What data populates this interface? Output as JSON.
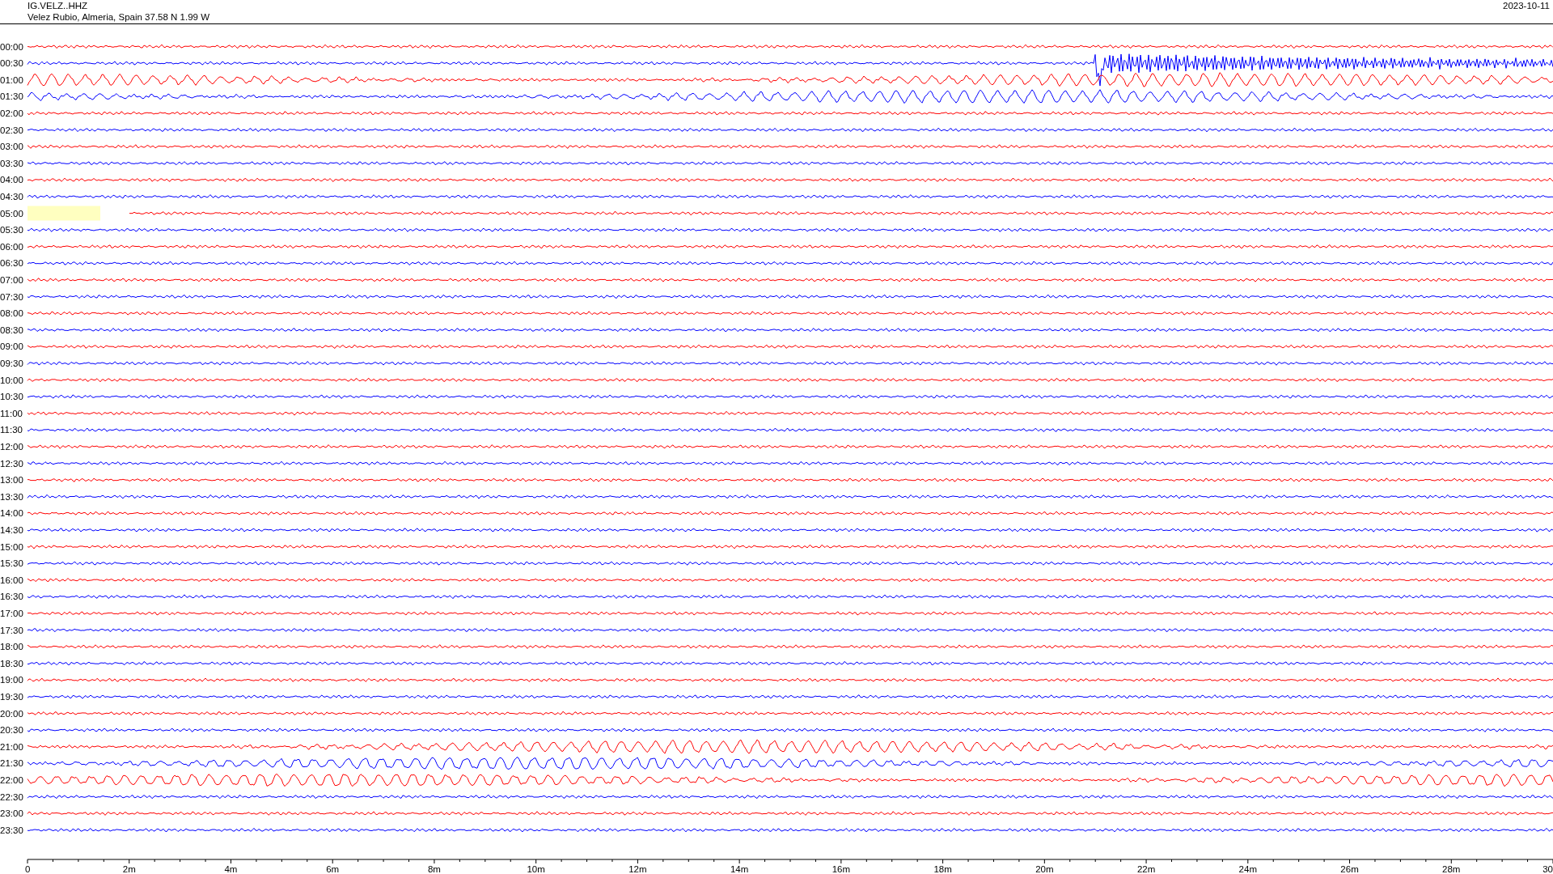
{
  "header": {
    "station": "IG.VELZ..HHZ",
    "location": "Velez Rubio, Almeria, Spain  37.58 N 1.99 W",
    "date": "2023-10-11"
  },
  "rows": [
    {
      "label": "00:00",
      "color": "#ff0000",
      "kind": "quiet",
      "marked": false
    },
    {
      "label": "00:30",
      "color": "#0000ff",
      "kind": "event",
      "marked": false
    },
    {
      "label": "01:00",
      "color": "#ff0000",
      "kind": "swell",
      "marked": false
    },
    {
      "label": "01:30",
      "color": "#0000ff",
      "kind": "swell",
      "marked": false
    },
    {
      "label": "02:00",
      "color": "#ff0000",
      "kind": "quiet",
      "marked": false
    },
    {
      "label": "02:30",
      "color": "#0000ff",
      "kind": "quiet",
      "marked": false
    },
    {
      "label": "03:00",
      "color": "#ff0000",
      "kind": "quiet",
      "marked": false
    },
    {
      "label": "03:30",
      "color": "#0000ff",
      "kind": "quiet",
      "marked": false
    },
    {
      "label": "04:00",
      "color": "#ff0000",
      "kind": "quiet",
      "marked": false
    },
    {
      "label": "04:30",
      "color": "#0000ff",
      "kind": "quiet",
      "marked": false
    },
    {
      "label": "05:00",
      "color": "#ff0000",
      "kind": "quiet",
      "marked": true
    },
    {
      "label": "05:30",
      "color": "#0000ff",
      "kind": "quiet",
      "marked": false
    },
    {
      "label": "06:00",
      "color": "#ff0000",
      "kind": "quiet",
      "marked": false
    },
    {
      "label": "06:30",
      "color": "#0000ff",
      "kind": "quiet",
      "marked": false
    },
    {
      "label": "07:00",
      "color": "#ff0000",
      "kind": "quiet",
      "marked": false
    },
    {
      "label": "07:30",
      "color": "#0000ff",
      "kind": "quiet",
      "marked": false
    },
    {
      "label": "08:00",
      "color": "#ff0000",
      "kind": "quiet",
      "marked": false
    },
    {
      "label": "08:30",
      "color": "#0000ff",
      "kind": "quiet",
      "marked": false
    },
    {
      "label": "09:00",
      "color": "#ff0000",
      "kind": "quiet",
      "marked": false
    },
    {
      "label": "09:30",
      "color": "#0000ff",
      "kind": "quiet",
      "marked": false
    },
    {
      "label": "10:00",
      "color": "#ff0000",
      "kind": "quiet",
      "marked": false
    },
    {
      "label": "10:30",
      "color": "#0000ff",
      "kind": "quiet",
      "marked": false
    },
    {
      "label": "11:00",
      "color": "#ff0000",
      "kind": "quiet",
      "marked": false
    },
    {
      "label": "11:30",
      "color": "#0000ff",
      "kind": "quiet",
      "marked": false
    },
    {
      "label": "12:00",
      "color": "#ff0000",
      "kind": "quiet",
      "marked": false
    },
    {
      "label": "12:30",
      "color": "#0000ff",
      "kind": "quiet",
      "marked": false
    },
    {
      "label": "13:00",
      "color": "#ff0000",
      "kind": "quiet",
      "marked": false
    },
    {
      "label": "13:30",
      "color": "#0000ff",
      "kind": "quiet",
      "marked": false
    },
    {
      "label": "14:00",
      "color": "#ff0000",
      "kind": "quiet",
      "marked": false
    },
    {
      "label": "14:30",
      "color": "#0000ff",
      "kind": "quiet",
      "marked": false
    },
    {
      "label": "15:00",
      "color": "#ff0000",
      "kind": "quiet",
      "marked": false
    },
    {
      "label": "15:30",
      "color": "#0000ff",
      "kind": "quiet",
      "marked": false
    },
    {
      "label": "16:00",
      "color": "#ff0000",
      "kind": "quiet",
      "marked": false
    },
    {
      "label": "16:30",
      "color": "#0000ff",
      "kind": "quiet",
      "marked": false
    },
    {
      "label": "17:00",
      "color": "#ff0000",
      "kind": "quiet",
      "marked": false
    },
    {
      "label": "17:30",
      "color": "#0000ff",
      "kind": "quiet",
      "marked": false
    },
    {
      "label": "18:00",
      "color": "#ff0000",
      "kind": "quiet",
      "marked": false
    },
    {
      "label": "18:30",
      "color": "#0000ff",
      "kind": "quiet",
      "marked": false
    },
    {
      "label": "19:00",
      "color": "#ff0000",
      "kind": "quiet",
      "marked": false
    },
    {
      "label": "19:30",
      "color": "#0000ff",
      "kind": "quiet",
      "marked": false
    },
    {
      "label": "20:00",
      "color": "#ff0000",
      "kind": "quiet",
      "marked": false
    },
    {
      "label": "20:30",
      "color": "#0000ff",
      "kind": "quiet",
      "marked": false
    },
    {
      "label": "21:00",
      "color": "#ff0000",
      "kind": "swell",
      "marked": false
    },
    {
      "label": "21:30",
      "color": "#0000ff",
      "kind": "swell",
      "marked": false
    },
    {
      "label": "22:00",
      "color": "#ff0000",
      "kind": "swell",
      "marked": false
    },
    {
      "label": "22:30",
      "color": "#0000ff",
      "kind": "quiet",
      "marked": false
    },
    {
      "label": "23:00",
      "color": "#ff0000",
      "kind": "quiet",
      "marked": false
    },
    {
      "label": "23:30",
      "color": "#0000ff",
      "kind": "quiet",
      "marked": false
    }
  ],
  "axis": {
    "ticks": [
      "0",
      "2m",
      "4m",
      "6m",
      "8m",
      "10m",
      "12m",
      "14m",
      "16m",
      "18m",
      "20m",
      "22m",
      "24m",
      "26m",
      "28m",
      "30"
    ]
  }
}
